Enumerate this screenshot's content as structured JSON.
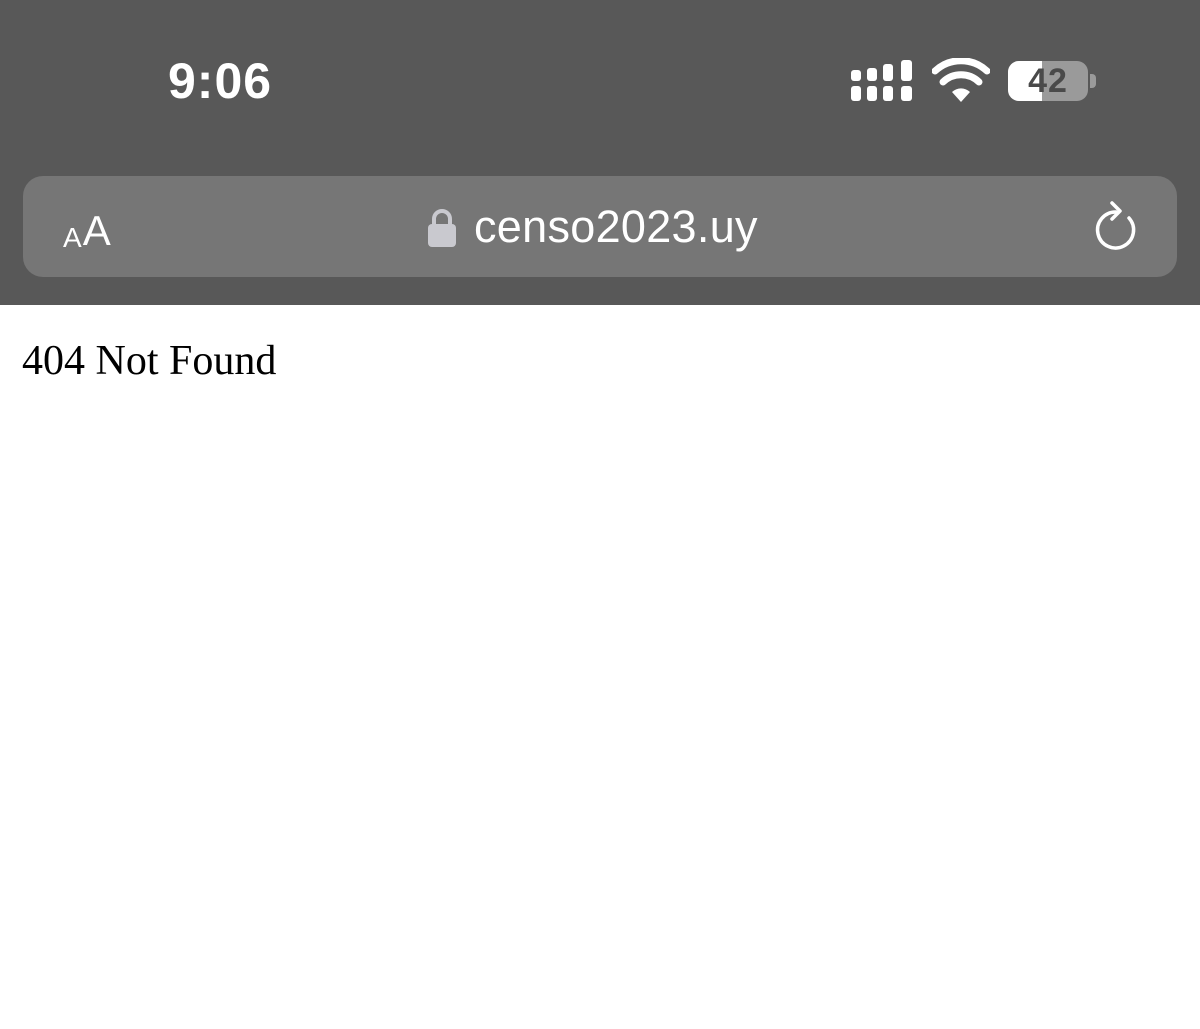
{
  "status_bar": {
    "time": "9:06",
    "icons": [
      "cellular-signal-icon",
      "wifi-icon",
      "battery-icon"
    ],
    "battery_level": "42",
    "battery_fraction": 0.42
  },
  "address_bar": {
    "text_size_small": "A",
    "text_size_large": "A",
    "url": "censo2023.uy",
    "icons": [
      "lock-icon",
      "reload-icon"
    ]
  },
  "page": {
    "message": "404 Not Found"
  },
  "colors": {
    "chrome_background": "#585858",
    "address_bar_background": "#767676",
    "page_background": "#ffffff"
  }
}
